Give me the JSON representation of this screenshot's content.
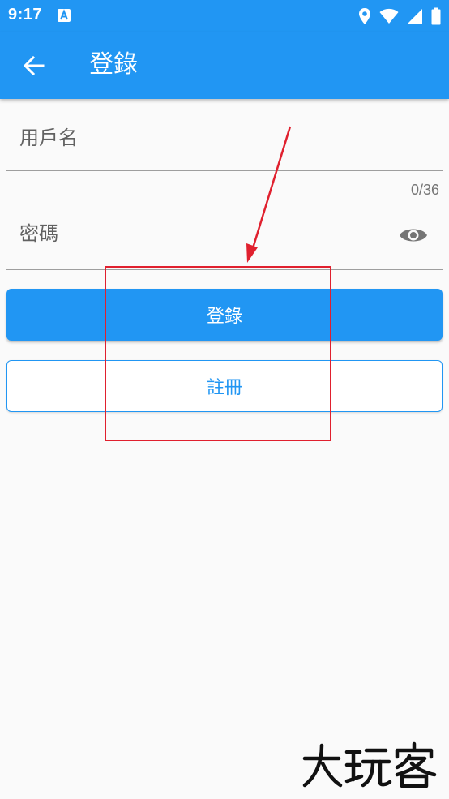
{
  "status_bar": {
    "time": "9:17"
  },
  "app_bar": {
    "title": "登錄"
  },
  "form": {
    "username_placeholder": "用戶名",
    "password_counter": "0/36",
    "password_placeholder": "密碼"
  },
  "buttons": {
    "login_label": "登錄",
    "register_label": "註冊"
  },
  "colors": {
    "primary": "#2196f3",
    "annotation": "#e0202e",
    "background": "#fafafa"
  },
  "watermark": {
    "text": "大玩客"
  }
}
